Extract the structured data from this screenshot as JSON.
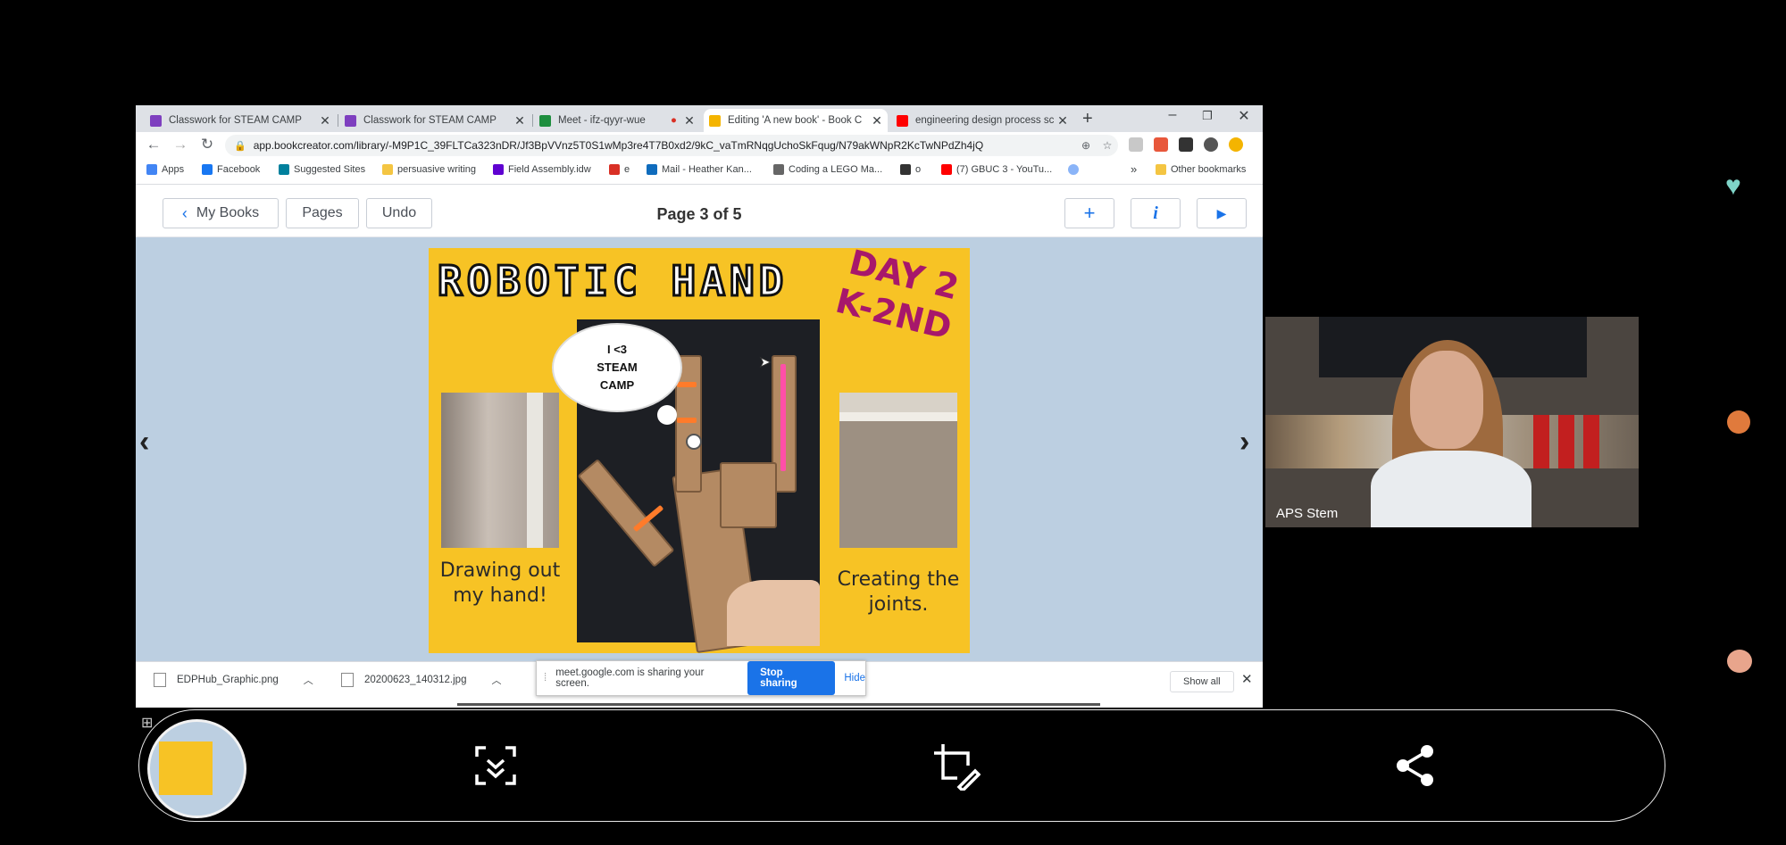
{
  "browser": {
    "tabs": [
      {
        "label": "Classwork for STEAM CAMP",
        "icon_color": "#7e3fbf",
        "active": false
      },
      {
        "label": "Classwork for STEAM CAMP",
        "icon_color": "#7e3fbf",
        "active": false
      },
      {
        "label": "Meet - ifz-qyyr-wue",
        "icon_color": "#1e8e3e",
        "active": false
      },
      {
        "label": "Editing 'A new book' - Book C",
        "icon_color": "#f4b400",
        "active": true
      },
      {
        "label": "engineering design process sc",
        "icon_color": "#ff0000",
        "active": false
      }
    ],
    "new_tab_symbol": "+",
    "window_controls": {
      "minimize": "–",
      "restore": "❐",
      "close": "✕"
    },
    "nav": {
      "back": "←",
      "forward": "→",
      "reload": "↻"
    },
    "url": "app.bookcreator.com/library/-M9P1C_39FLTCa323nDR/Jf3BpVVnz5T0S1wMp3re4T7B0xd2/9kC_vaTmRNqgUchoSkFqug/N79akWNpR2KcTwNPdZh4jQ",
    "bookmarks": [
      {
        "label": "Apps",
        "icon": "apps-grid-icon",
        "color": "#4285f4"
      },
      {
        "label": "Facebook",
        "icon": "facebook-icon",
        "color": "#1877f2"
      },
      {
        "label": "Suggested Sites",
        "icon": "bing-icon",
        "color": "#00809d"
      },
      {
        "label": "persuasive writing",
        "icon": "folder-icon",
        "color": "#f4c542"
      },
      {
        "label": "Field Assembly.idw",
        "icon": "yahoo-icon",
        "color": "#5f01d1"
      },
      {
        "label": "e",
        "icon": "gmail-icon",
        "color": "#d93025"
      },
      {
        "label": "Mail - Heather Kan...",
        "icon": "outlook-icon",
        "color": "#0f6cbd"
      },
      {
        "label": "Coding a LEGO Ma...",
        "icon": "page-icon",
        "color": "#666666"
      },
      {
        "label": "o",
        "icon": "film-icon",
        "color": "#333333"
      },
      {
        "label": "(7) GBUC 3 - YouTu...",
        "icon": "youtube-icon",
        "color": "#ff0000"
      },
      {
        "label": "",
        "icon": "globe-icon",
        "color": "#8ab4f8"
      }
    ],
    "bookmarks_overflow": "»",
    "other_bookmarks": "Other bookmarks"
  },
  "app": {
    "my_books_label": "My Books",
    "pages_label": "Pages",
    "undo_label": "Undo",
    "page_indicator": "Page 3 of 5",
    "add_symbol": "+",
    "info_symbol": "i",
    "play_symbol": "▶",
    "prev_symbol": "‹",
    "next_symbol": "›"
  },
  "poster": {
    "title": "ROBOTIC HAND",
    "day": "DAY 2",
    "grade": "K-2ND",
    "bubble_line1": "I <3",
    "bubble_line2": "STEAM",
    "bubble_line3": "CAMP",
    "caption_left_1": "Drawing out",
    "caption_left_2": "my hand!",
    "caption_right_1": "Creating the",
    "caption_right_2": "joints."
  },
  "downloads": {
    "items": [
      "EDPHub_Graphic.png",
      "20200623_140312.jpg"
    ],
    "share_text": "meet.google.com is sharing your screen.",
    "stop_sharing": "Stop sharing",
    "hide": "Hide",
    "show_all": "Show all"
  },
  "video": {
    "participant_name": "APS Stem"
  },
  "reactions": [
    "heart-icon",
    "cat-icon",
    "paw-icon"
  ],
  "capture_toolbar": {
    "actions": [
      "scroll-capture-icon",
      "crop-edit-icon",
      "share-icon"
    ]
  }
}
